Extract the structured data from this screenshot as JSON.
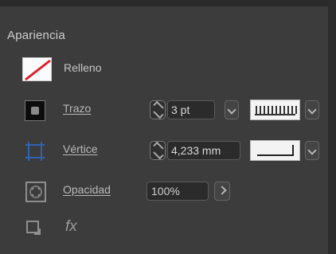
{
  "panel": {
    "title": "Apariencia",
    "fill": {
      "label": "Relleno"
    },
    "stroke": {
      "label": "Trazo",
      "value": "3 pt"
    },
    "vertex": {
      "label": "Vértice",
      "value": "4,233 mm"
    },
    "opacity": {
      "label": "Opacidad",
      "value": "100%"
    },
    "fx_label": "fx"
  },
  "icons": [
    "fill-swatch-icon",
    "stroke-swatch-icon",
    "vertex-icon",
    "opacity-icon",
    "bottom-square-icon",
    "fx-icon",
    "stepper-icon",
    "dropdown-icon",
    "stroke-preview-icon",
    "corner-preview-icon",
    "arrow-right-icon"
  ],
  "colors": {
    "panel_bg": "#3c3c3c",
    "strip_bg": "#2a2a2a",
    "text": "#d2d2d2",
    "field_bg": "#2b2b2b",
    "accent_red": "#e11d2a",
    "vertex_blue": "#2f63b3"
  }
}
